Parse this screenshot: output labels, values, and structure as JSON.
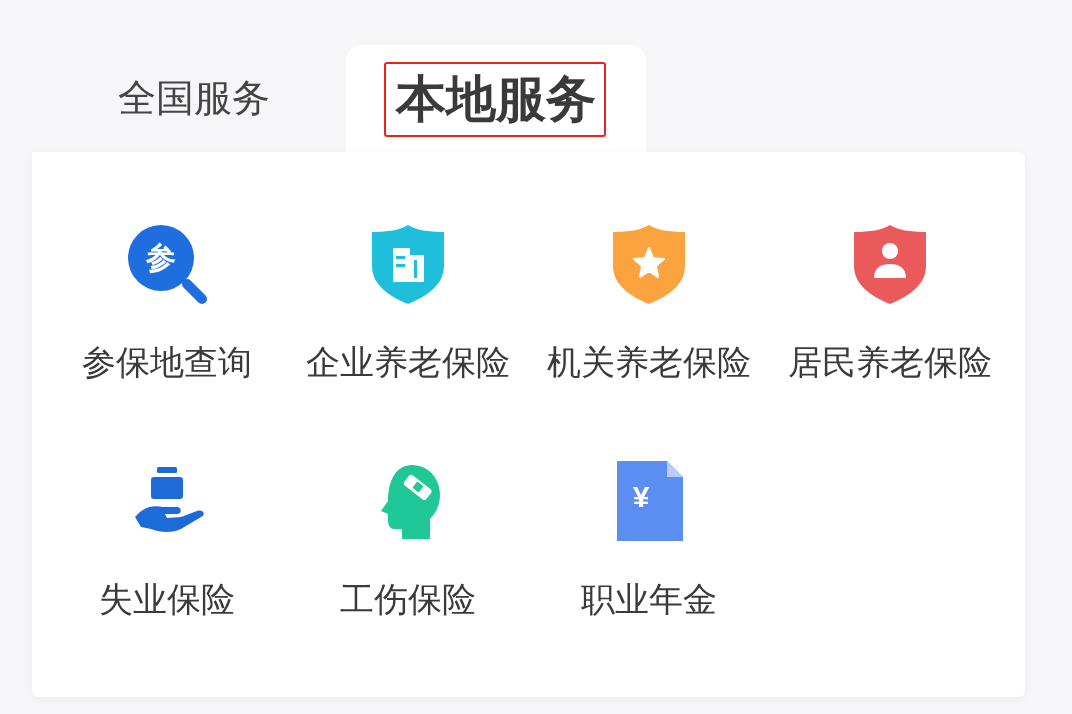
{
  "tabs": [
    {
      "label": "全国服务",
      "selected": false,
      "highlighted": false
    },
    {
      "label": "本地服务",
      "selected": true,
      "highlighted": true
    }
  ],
  "services": [
    {
      "label": "参保地查询",
      "kind": "magnifier",
      "color": "#1f6ee0",
      "icon_text": "参"
    },
    {
      "label": "企业养老保险",
      "kind": "shield-building",
      "color": "#1fbfdc"
    },
    {
      "label": "机关养老保险",
      "kind": "shield-star",
      "color": "#fba33f"
    },
    {
      "label": "居民养老保险",
      "kind": "shield-person",
      "color": "#ea5a5a"
    },
    {
      "label": "失业保险",
      "kind": "hand-box",
      "color": "#1d6ad9"
    },
    {
      "label": "工伤保险",
      "kind": "head-bandage",
      "color": "#1fc896"
    },
    {
      "label": "职业年金",
      "kind": "document",
      "color": "#5b8ef0",
      "icon_text": "¥"
    }
  ]
}
